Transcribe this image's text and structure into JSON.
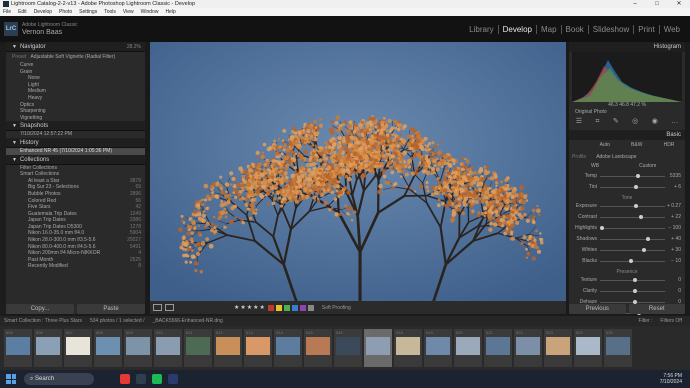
{
  "window": {
    "title": "Lightroom Catalog-2-2-v13 - Adobe Photoshop Lightroom Classic - Develop",
    "controls": [
      "–",
      "□",
      "✕"
    ]
  },
  "menu": [
    "File",
    "Edit",
    "Develop",
    "Photo",
    "Settings",
    "Tools",
    "View",
    "Window",
    "Help"
  ],
  "identity": {
    "badge": "LrC",
    "product": "Adobe Lightroom Classic",
    "user": "Vernon Baas"
  },
  "modules": [
    "Library",
    "Develop",
    "Map",
    "Book",
    "Slideshow",
    "Print",
    "Web"
  ],
  "active_module": "Develop",
  "navigator": {
    "title": "Navigator",
    "zoom_options": [
      "FIT",
      "FILL",
      "100%",
      "28.2%"
    ]
  },
  "presets": {
    "preset_label": "Preset",
    "preset_value": "Adjustable Soft Vignette (Radial Filter)",
    "groups": [
      "Curve",
      "Grain"
    ],
    "grain_items": [
      "None",
      "Light",
      "Medium",
      "Heavy"
    ],
    "after": [
      "Optics",
      "Sharpening",
      "Vignetting"
    ]
  },
  "snapshots": {
    "title": "Snapshots",
    "items": [
      "7/10/2024 12:57:22 PM"
    ]
  },
  "history": {
    "title": "History",
    "items": [
      "Enhanced NR 45 (7/10/2024 1:05:36 PM)"
    ]
  },
  "collections": {
    "title": "Collections",
    "items": [
      {
        "label": "Filter Collections",
        "count": ""
      },
      {
        "label": "Smart Collections",
        "count": ""
      },
      {
        "label": "At least a Star",
        "count": "3879"
      },
      {
        "label": "Big Sur 23 - Selections",
        "count": "69"
      },
      {
        "label": "Bubble Photos",
        "count": "2896"
      },
      {
        "label": "Colored Red",
        "count": "56"
      },
      {
        "label": "Five Stars",
        "count": "42"
      },
      {
        "label": "Guatemala Trip Dates",
        "count": "1249"
      },
      {
        "label": "Japan Trip Dates",
        "count": "3386"
      },
      {
        "label": "Japan Trip Dates D5300",
        "count": "1278"
      },
      {
        "label": "Nikon 16.0-35.0 mm f/4.0",
        "count": "5904"
      },
      {
        "label": "Nikon 28.0-300.0 mm f/3.5-5.6",
        "count": "29227"
      },
      {
        "label": "Nikon 80.0-400.0 mm f/4.5-5.6",
        "count": "5491"
      },
      {
        "label": "Nikon 200mm f/4 Micro-NIKKOR",
        "count": "4"
      },
      {
        "label": "Past Month",
        "count": "2525"
      },
      {
        "label": "Recently Modified",
        "count": "8"
      }
    ]
  },
  "left_buttons": [
    "Copy...",
    "Paste"
  ],
  "toolbar": {
    "stars": "★★★★★",
    "before_after": "Before & After",
    "soft_proofing": "Soft Proofing",
    "swatch_colors": [
      "#c0392b",
      "#e6c229",
      "#4caf50",
      "#3a7bd5",
      "#8e44ad",
      "#888888"
    ]
  },
  "histogram": {
    "title": "Histogram",
    "readout": "46.3   46.8   47.2  %",
    "original_photo": "Original Photo"
  },
  "basic": {
    "title": "Basic",
    "modes": [
      "Auto",
      "B&W",
      "HDR"
    ],
    "profile_label": "Profile",
    "profile_value": "Adobe Landscape",
    "wb_label": "WB",
    "wb_value": "Custom",
    "sliders": [
      {
        "name": "Temp",
        "value": "5335",
        "pos": 0.55
      },
      {
        "name": "Tint",
        "value": "+ 6",
        "pos": 0.52
      },
      {
        "name": "Exposure",
        "value": "+ 0.27",
        "pos": 0.53
      },
      {
        "name": "Contrast",
        "value": "+ 22",
        "pos": 0.6
      },
      {
        "name": "Highlights",
        "value": "− 100",
        "pos": 0.0
      },
      {
        "name": "Shadows",
        "value": "+ 40",
        "pos": 0.7
      },
      {
        "name": "Whites",
        "value": "+ 30",
        "pos": 0.65
      },
      {
        "name": "Blacks",
        "value": "− 10",
        "pos": 0.45
      },
      {
        "name": "Texture",
        "value": "0",
        "pos": 0.5
      },
      {
        "name": "Clarity",
        "value": "0",
        "pos": 0.5
      },
      {
        "name": "Dehaze",
        "value": "0",
        "pos": 0.5
      },
      {
        "name": "Vibrance",
        "value": "+ 15",
        "pos": 0.57
      }
    ],
    "tone_label": "Tone",
    "presence_label": "Presence"
  },
  "right_buttons": [
    "Previous",
    "Reset"
  ],
  "filmstrip_bar": {
    "source": "Smart Collection : Three Plus Stars",
    "count": "534 photos / 1 selected /",
    "file": "_BACK5566-Enhanced-NR.dng",
    "filter_label": "Filter :",
    "filter_value": "Filters Off"
  },
  "thumbnails": [
    {
      "no": "505",
      "color": "#5a7fa3"
    },
    {
      "no": "506",
      "color": "#8aa0b4"
    },
    {
      "no": "507",
      "color": "#e8e4da"
    },
    {
      "no": "508",
      "color": "#6d8fb0"
    },
    {
      "no": "509",
      "color": "#7c93a8"
    },
    {
      "no": "510",
      "color": "#8a9db0"
    },
    {
      "no": "511",
      "color": "#4d6a55"
    },
    {
      "no": "512",
      "color": "#c98f5a"
    },
    {
      "no": "513",
      "color": "#d89868"
    },
    {
      "no": "514",
      "color": "#5d7da0"
    },
    {
      "no": "515",
      "color": "#b87a55"
    },
    {
      "no": "516",
      "color": "#3a4a5a"
    },
    {
      "no": "517",
      "color": "#8d9eb2"
    },
    {
      "no": "518",
      "color": "#c8b89a"
    },
    {
      "no": "519",
      "color": "#6f8aa8"
    },
    {
      "no": "520",
      "color": "#9aaabb"
    },
    {
      "no": "521",
      "color": "#5c7796"
    },
    {
      "no": "522",
      "color": "#7b90a6"
    },
    {
      "no": "523",
      "color": "#c9a47a"
    },
    {
      "no": "524",
      "color": "#a9b9c9"
    },
    {
      "no": "525",
      "color": "#586f88"
    }
  ],
  "selected_thumb": "517",
  "taskbar": {
    "search": "Search",
    "time": "7:56 PM",
    "date": "7/10/2024",
    "app_colors": [
      "#e53935",
      "#2c3e50",
      "#1db954",
      "#2a3a6a"
    ]
  }
}
